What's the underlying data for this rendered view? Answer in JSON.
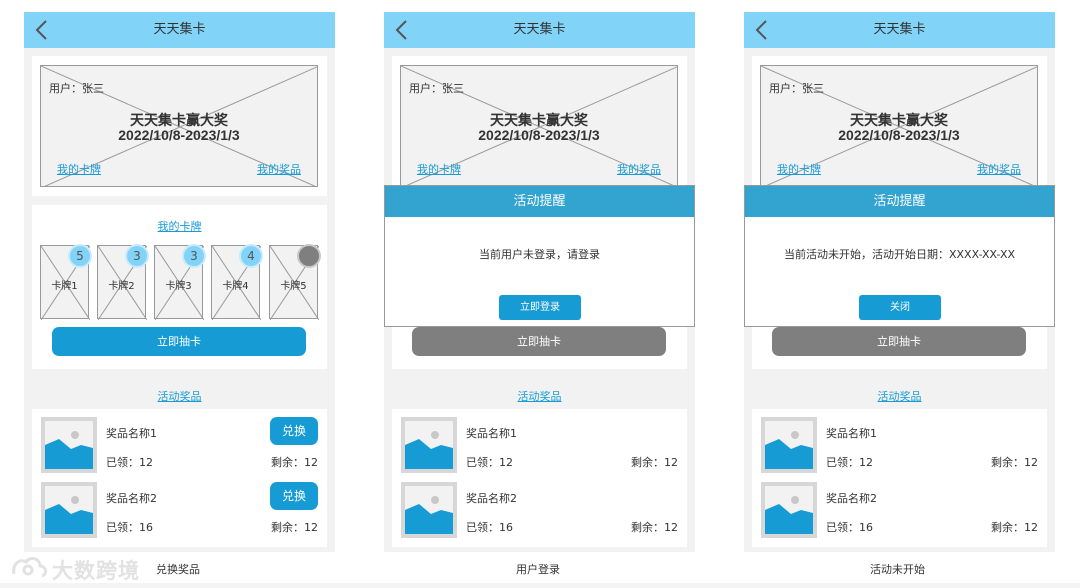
{
  "app": {
    "title": "天天集卡"
  },
  "banner": {
    "user": "用户：张三",
    "title": "天天集卡赢大奖",
    "date": "2022/10/8-2023/1/3",
    "my_cards_link": "我的卡牌",
    "my_prizes_link": "我的奖品"
  },
  "cards_section": {
    "title": "我的卡牌",
    "cards": [
      {
        "label": "卡牌1",
        "count": "5"
      },
      {
        "label": "卡牌2",
        "count": "3"
      },
      {
        "label": "卡牌3",
        "count": "3"
      },
      {
        "label": "卡牌4",
        "count": "4"
      },
      {
        "label": "卡牌5",
        "count": ""
      }
    ],
    "draw_button": "立即抽卡"
  },
  "prizes_section": {
    "title": "活动奖品",
    "prizes": [
      {
        "name": "奖品名称1",
        "claimed": "已领：12",
        "remaining": "剩余：12",
        "button": "兑换"
      },
      {
        "name": "奖品名称2",
        "claimed": "已领：16",
        "remaining": "剩余：12",
        "button": "兑换"
      }
    ]
  },
  "dialogs": {
    "login": {
      "title": "活动提醒",
      "message": "当前用户未登录，请登录",
      "button": "立即登录"
    },
    "not_started": {
      "title": "活动提醒",
      "message": "当前活动未开始，活动开始日期：XXXX-XX-XX",
      "button": "关闭"
    }
  },
  "captions": {
    "screen1": "兑换奖品",
    "screen2": "用户登录",
    "screen3": "活动未开始"
  },
  "watermark": {
    "text": "大数跨境"
  },
  "colors": {
    "header": "#81d3f8",
    "accent": "#169bd5",
    "dialog_header": "#33a3d0",
    "disabled": "#7f7f7f",
    "badge": "#81d3f8"
  }
}
